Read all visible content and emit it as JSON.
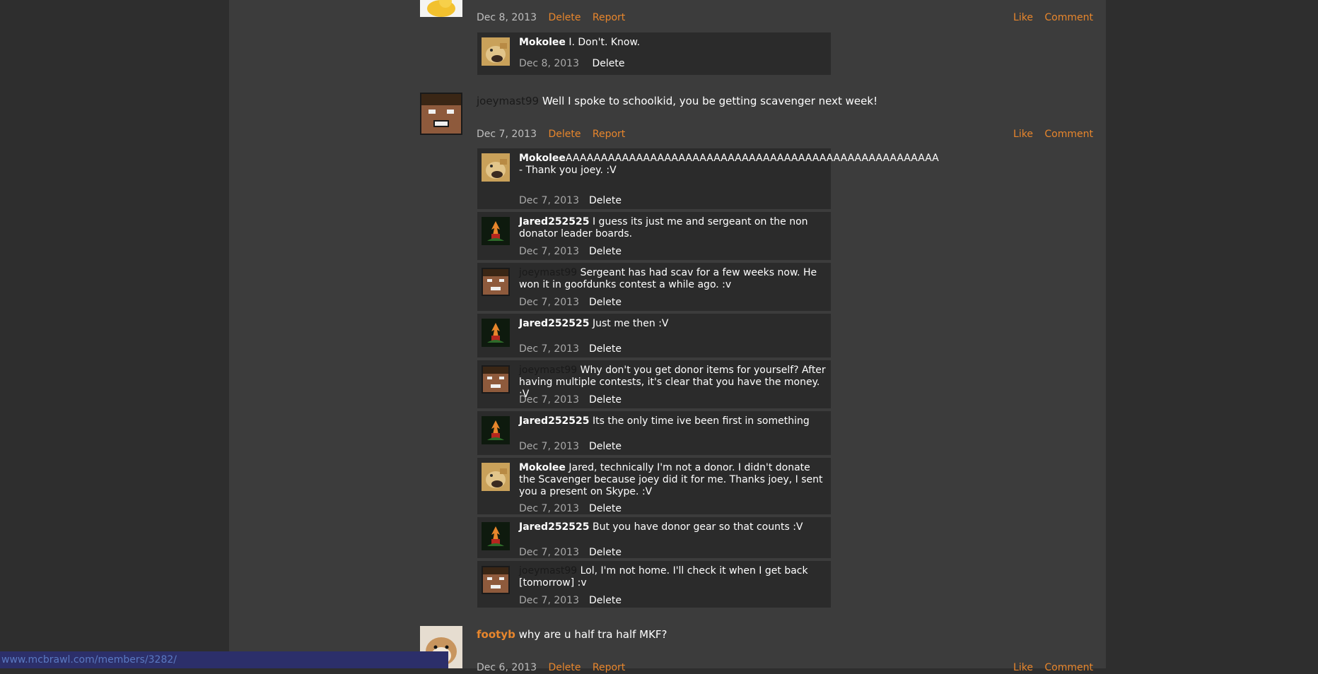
{
  "top_post": {
    "date": "Dec 8, 2013",
    "delete": "Delete",
    "report": "Report",
    "like": "Like",
    "comment": "Comment"
  },
  "top_comment": {
    "user": "Mokolee",
    "text": " I. Don't. Know.",
    "date": "Dec 8, 2013",
    "delete": "Delete"
  },
  "post_joey": {
    "user": "joeymast99",
    "text": " Well I spoke to schoolkid, you be getting scavenger next week!",
    "date": "Dec 7, 2013",
    "delete": "Delete",
    "report": "Report",
    "like": "Like",
    "comment": "Comment"
  },
  "comments": [
    {
      "user": "Mokolee",
      "style": "bold",
      "avatar": "doge",
      "text": "AAAAAAAAAAAAAAAAAAAAAAAAAAAAAAAAAAAAAAAAAAAAAAAAAAAAA - Thank you joey. :V",
      "date": "Dec 7, 2013",
      "delete": "Delete"
    },
    {
      "user": "Jared252525",
      "style": "bold",
      "avatar": "fire",
      "text": " I guess its just me and sergeant on the non donator leader boards.",
      "date": "Dec 7, 2013",
      "delete": "Delete"
    },
    {
      "user": "joeymast99",
      "style": "dark",
      "avatar": "steve",
      "text": " Sergeant has had scav for a few weeks now. He won it in goofdunks contest a while ago. :v",
      "date": "Dec 7, 2013",
      "delete": "Delete"
    },
    {
      "user": "Jared252525",
      "style": "bold",
      "avatar": "fire",
      "text": " Just me then :V",
      "date": "Dec 7, 2013",
      "delete": "Delete"
    },
    {
      "user": "joeymast99",
      "style": "dark",
      "avatar": "steve",
      "text": " Why don't you get donor items for yourself? After having multiple contests, it's clear that you have the money. :V",
      "date": "Dec 7, 2013",
      "delete": "Delete"
    },
    {
      "user": "Jared252525",
      "style": "bold",
      "avatar": "fire",
      "text": " Its the only time ive been first in something",
      "date": "Dec 7, 2013",
      "delete": "Delete"
    },
    {
      "user": "Mokolee",
      "style": "bold",
      "avatar": "doge",
      "text": " Jared, technically I'm not a donor. I didn't donate the Scavenger because joey did it for me. Thanks joey, I sent you a present on Skype. :V",
      "date": "Dec 7, 2013",
      "delete": "Delete"
    },
    {
      "user": "Jared252525",
      "style": "bold",
      "avatar": "fire",
      "text": " But you have donor gear so that counts :V",
      "date": "Dec 7, 2013",
      "delete": "Delete"
    },
    {
      "user": "joeymast99",
      "style": "dark",
      "avatar": "steve",
      "text": " Lol, I'm not home. I'll check it when I get back [tomorrow] :v",
      "date": "Dec 7, 2013",
      "delete": "Delete"
    }
  ],
  "post_footyb": {
    "user": "footyb",
    "text": " why are u half tra half MKF?",
    "date": "Dec 6, 2013",
    "delete": "Delete",
    "report": "Report",
    "like": "Like",
    "comment": "Comment"
  },
  "status_bar": {
    "url": "www.mcbrawl.com/members/3282/"
  },
  "colors": {
    "accent": "#e8862c",
    "page_bg": "#2e2e2e",
    "column_bg": "#3c3c3c",
    "comment_bg": "#2b2b2b"
  }
}
